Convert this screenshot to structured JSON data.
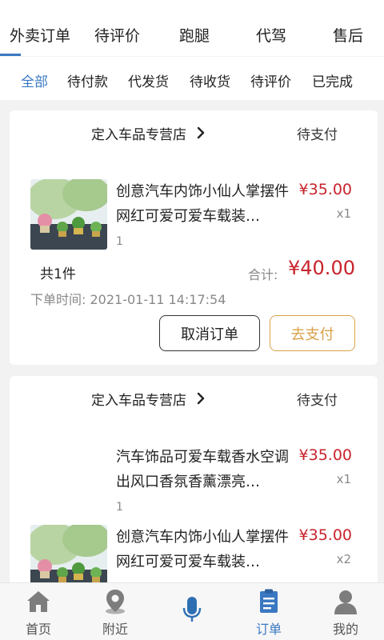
{
  "top_tabs": [
    "外卖订单",
    "待评价",
    "跑腿",
    "代驾",
    "售后"
  ],
  "sub_tabs": [
    "全部",
    "待付款",
    "代发货",
    "待收货",
    "待评价",
    "已完成"
  ],
  "orders": [
    {
      "shop": "定入车品专营店",
      "status": "待支付",
      "items": [
        {
          "title": "创意汽车内饰小仙人掌摆件网红可爱可爱车载装…",
          "price": "¥35.00",
          "qty": "x1",
          "spec": "1"
        }
      ],
      "total_count": "共1件",
      "total_label": "合计:",
      "total_amount": "¥40.00",
      "order_time": "下单时间: 2021-01-11 14:17:54",
      "cancel_label": "取消订单",
      "pay_label": "去支付"
    },
    {
      "shop": "定入车品专营店",
      "status": "待支付",
      "items": [
        {
          "title": "汽车饰品可爱车载香水空调出风口香氛香薰漂亮…",
          "price": "¥35.00",
          "qty": "x1",
          "spec": "1"
        },
        {
          "title": "创意汽车内饰小仙人掌摆件网红可爱可爱车载装…",
          "price": "¥35.00",
          "qty": "x2"
        }
      ]
    }
  ],
  "bottom_nav": [
    {
      "label": "首页",
      "icon": "home-icon"
    },
    {
      "label": "附近",
      "icon": "location-pin-icon"
    },
    {
      "label": "",
      "icon": "microphone-icon"
    },
    {
      "label": "订单",
      "icon": "order-list-icon"
    },
    {
      "label": "我的",
      "icon": "user-icon"
    }
  ],
  "colors": {
    "accent": "#3a78c2",
    "price": "#c8232c",
    "pay_button": "#d8a24a"
  }
}
